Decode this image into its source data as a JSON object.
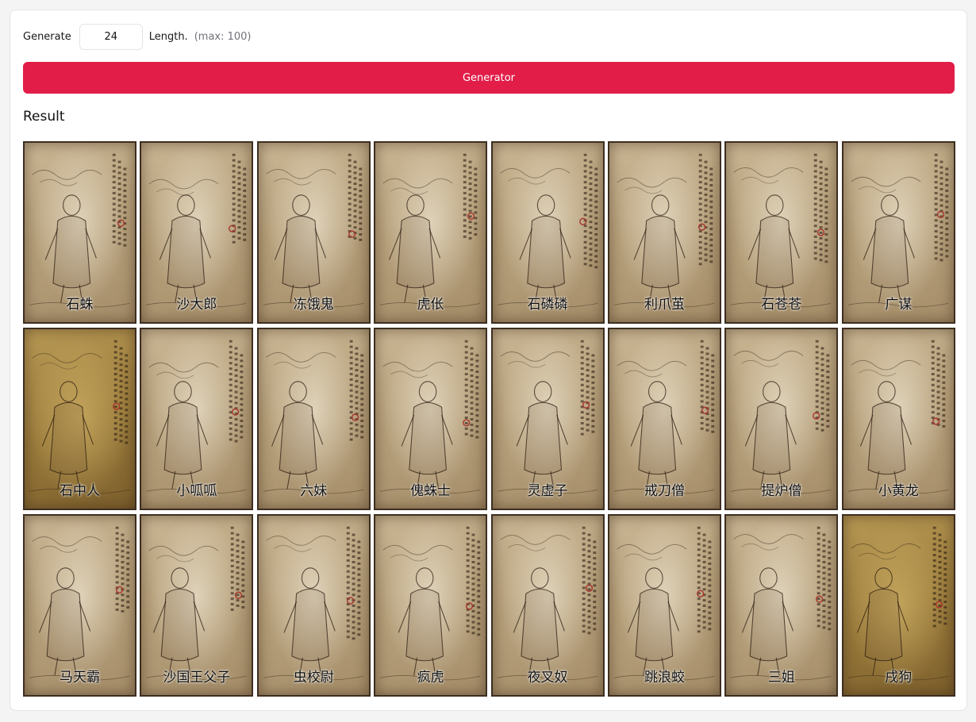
{
  "controls": {
    "generate_label": "Generate",
    "length_value": "24",
    "length_label": "Length.",
    "max_hint": "(max: 100)"
  },
  "generator_button": "Generator",
  "result_title": "Result",
  "colors": {
    "accent": "#e11d48",
    "card_border": "#3d2e20",
    "parchment": "#c2ac87"
  },
  "cards": [
    {
      "name": "石蛛"
    },
    {
      "name": "沙大郎"
    },
    {
      "name": "冻饿鬼"
    },
    {
      "name": "虎伥"
    },
    {
      "name": "石磷磷"
    },
    {
      "name": "利爪茧"
    },
    {
      "name": "石苍苍"
    },
    {
      "name": "广谋"
    },
    {
      "name": "石中人"
    },
    {
      "name": "小呱呱"
    },
    {
      "name": "六妹"
    },
    {
      "name": "傀蛛士"
    },
    {
      "name": "灵虚子"
    },
    {
      "name": "戒刀僧"
    },
    {
      "name": "提炉僧"
    },
    {
      "name": "小黄龙"
    },
    {
      "name": "马天霸"
    },
    {
      "name": "沙国王父子"
    },
    {
      "name": "虫校尉"
    },
    {
      "name": "疯虎"
    },
    {
      "name": "夜叉奴"
    },
    {
      "name": "跳浪蛟"
    },
    {
      "name": "三姐"
    },
    {
      "name": "戌狗"
    }
  ]
}
